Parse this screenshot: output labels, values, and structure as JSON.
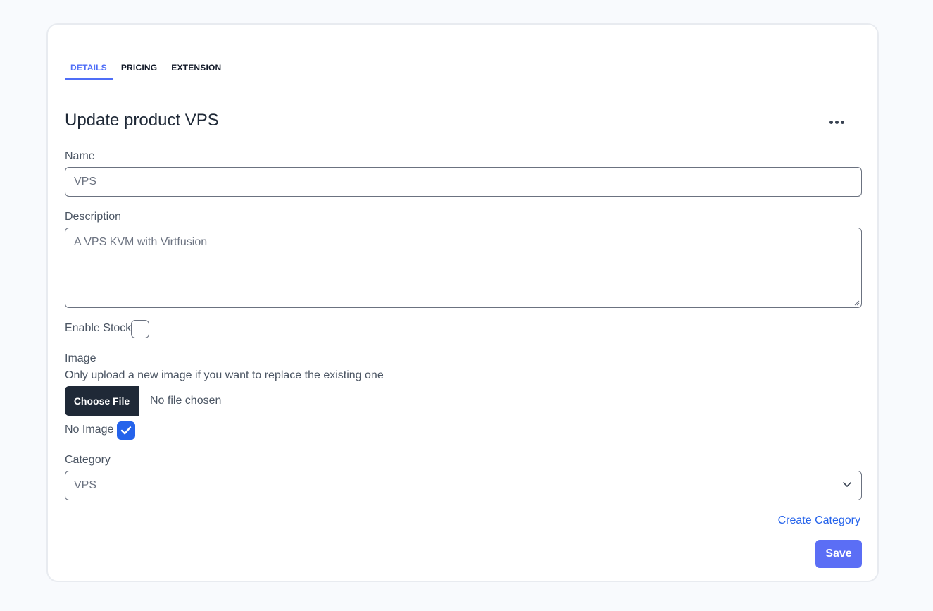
{
  "tabs": [
    {
      "label": "DETAILS",
      "active": true
    },
    {
      "label": "PRICING",
      "active": false
    },
    {
      "label": "EXTENSION",
      "active": false
    }
  ],
  "title": "Update product VPS",
  "more_icon": "more-horizontal-icon",
  "form": {
    "name_label": "Name",
    "name_value": "VPS",
    "description_label": "Description",
    "description_value": "A VPS KVM with Virtfusion",
    "enable_stock_label": "Enable Stock",
    "enable_stock_checked": false,
    "image_label": "Image",
    "image_hint": "Only upload a new image if you want to replace the existing one",
    "choose_file_label": "Choose File",
    "file_status": "No file chosen",
    "no_image_label": "No Image",
    "no_image_checked": true,
    "category_label": "Category",
    "category_value": "VPS",
    "create_category_label": "Create Category",
    "save_label": "Save"
  },
  "colors": {
    "accent": "#4f6ef7",
    "save_button": "#5b6ef5",
    "checkbox_checked": "#2563eb",
    "file_button": "#1f2937",
    "link": "#2563eb"
  }
}
